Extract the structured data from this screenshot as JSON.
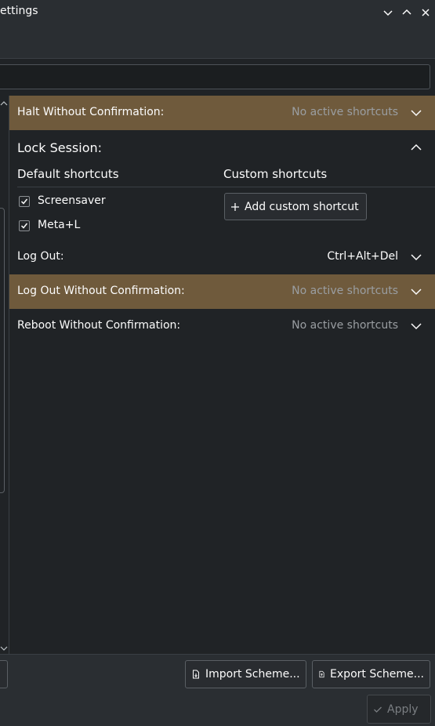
{
  "window": {
    "title": "ettings",
    "minimize_icon": "chevron-down-icon",
    "maximize_icon": "chevron-up-icon",
    "close_icon": "close-icon"
  },
  "search": {
    "value": ""
  },
  "shortcuts": {
    "halt": {
      "label": "Halt Without Confirmation:",
      "value": "No active shortcuts"
    },
    "lock": {
      "label": "Lock Session:",
      "default_header": "Default shortcuts",
      "custom_header": "Custom shortcuts",
      "defaults": [
        {
          "label": "Screensaver",
          "checked": true
        },
        {
          "label": "Meta+L",
          "checked": true
        }
      ],
      "add_custom_label": "Add custom shortcut"
    },
    "logout": {
      "label": "Log Out:",
      "value": "Ctrl+Alt+Del"
    },
    "logout_noconfirm": {
      "label": "Log Out Without Confirmation:",
      "value": "No active shortcuts"
    },
    "reboot_noconfirm": {
      "label": "Reboot Without Confirmation:",
      "value": "No active shortcuts"
    }
  },
  "footer": {
    "import_label": "Import Scheme...",
    "export_label": "Export Scheme...",
    "apply_label": "Apply"
  },
  "colors": {
    "highlight_row": "#6f5a3c",
    "background": "#202326",
    "muted_text": "#9a9ea2"
  }
}
